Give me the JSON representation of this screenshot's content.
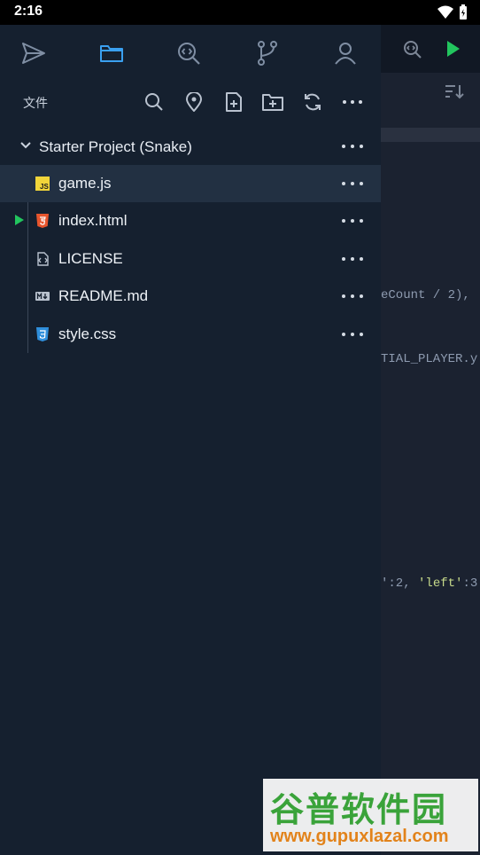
{
  "status": {
    "time": "2:16"
  },
  "drawer": {
    "section_title": "文件",
    "project": {
      "name": "Starter Project (Snake)"
    },
    "files": [
      {
        "name": "game.js",
        "icon": "js-file-icon",
        "selected": true,
        "running": false
      },
      {
        "name": "index.html",
        "icon": "html5-file-icon",
        "selected": false,
        "running": true
      },
      {
        "name": "LICENSE",
        "icon": "code-file-icon",
        "selected": false,
        "running": false
      },
      {
        "name": "README.md",
        "icon": "markdown-file-icon",
        "selected": false,
        "running": false
      },
      {
        "name": "style.css",
        "icon": "css3-file-icon",
        "selected": false,
        "running": false
      }
    ]
  },
  "editor": {
    "code_line_1": "eCount / 2),",
    "code_line_2": "TIAL_PLAYER.y",
    "code_line_3a": "':2, ",
    "code_line_3b": "'left'",
    "code_line_3c": ":3"
  },
  "watermark": {
    "cn": "谷普软件园",
    "url": "www.gupuxlazal.com"
  },
  "colors": {
    "accent": "#3aa0f0",
    "run": "#22c55e",
    "drawer_bg": "#15202f"
  }
}
